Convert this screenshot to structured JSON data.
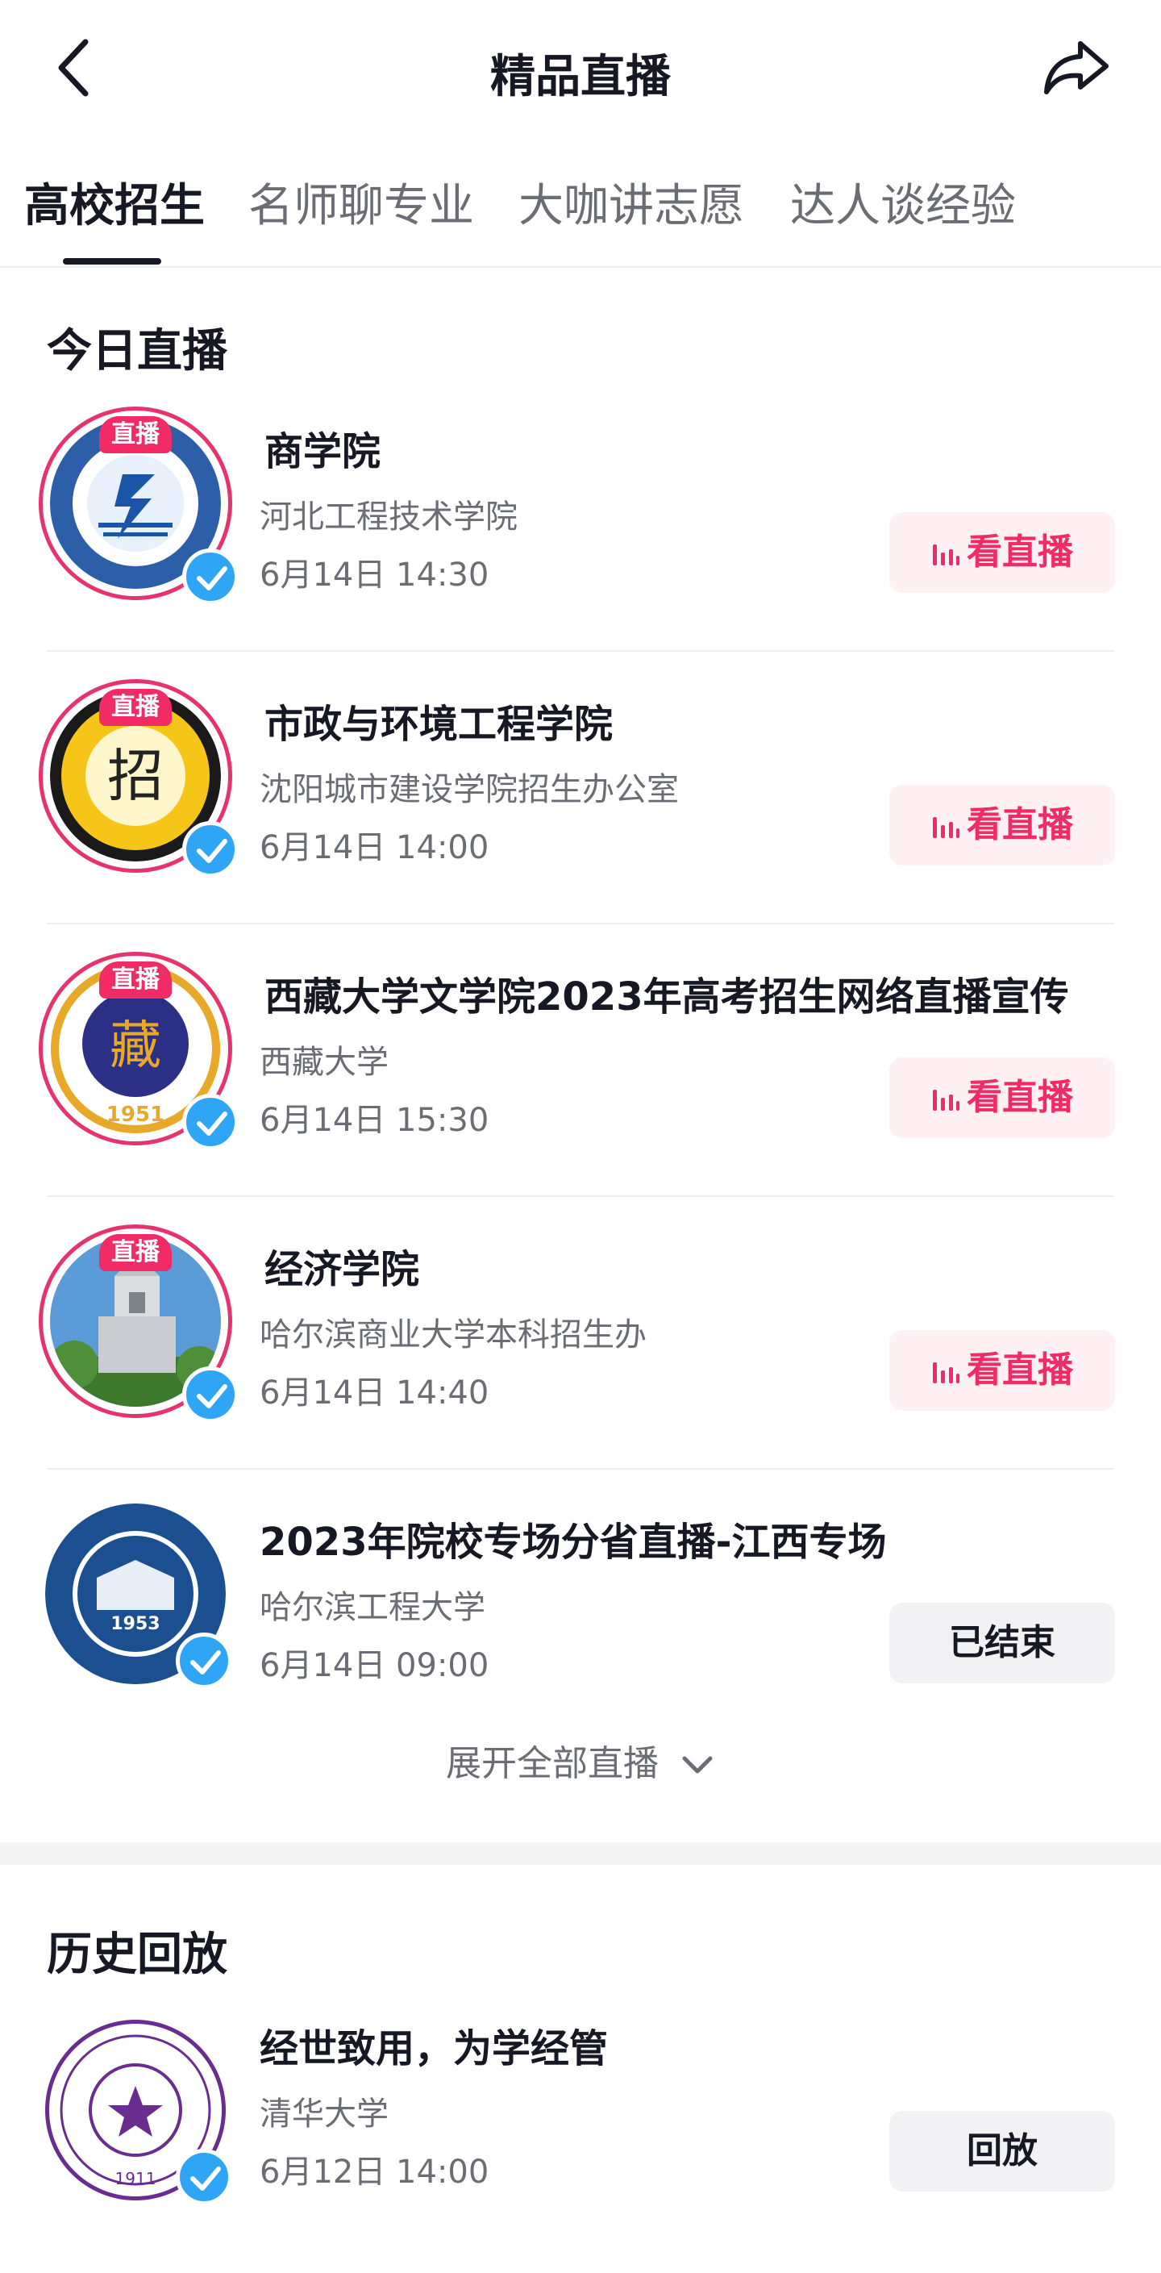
{
  "header": {
    "title": "精品直播",
    "back_icon": "chevron-left-icon",
    "share_icon": "share-arrow-icon"
  },
  "tabs": [
    {
      "label": "高校招生",
      "active": true
    },
    {
      "label": "名师聊专业",
      "active": false
    },
    {
      "label": "大咖讲志愿",
      "active": false
    },
    {
      "label": "达人谈经验",
      "active": false
    }
  ],
  "today": {
    "title": "今日直播",
    "items": [
      {
        "name": "商学院",
        "org": "河北工程技术学院",
        "time": "6月14日 14:30",
        "badge": "直播",
        "action": "看直播",
        "status": "live",
        "avatar": "hebei-polytechnic-logo"
      },
      {
        "name": "市政与环境工程学院",
        "org": "沈阳城市建设学院招生办公室",
        "time": "6月14日 14:00",
        "badge": "直播",
        "action": "看直播",
        "status": "live",
        "avatar": "shenyang-urban-construction-logo"
      },
      {
        "name": "西藏大学文学院2023年高考招生网络直播宣传",
        "org": "西藏大学",
        "time": "6月14日 15:30",
        "badge": "直播",
        "action": "看直播",
        "status": "live",
        "avatar": "tibet-university-logo"
      },
      {
        "name": "经济学院",
        "org": "哈尔滨商业大学本科招生办",
        "time": "6月14日 14:40",
        "badge": "直播",
        "action": "看直播",
        "status": "live",
        "avatar": "building-photo"
      },
      {
        "name": "2023年院校专场分省直播-江西专场",
        "org": "哈尔滨工程大学",
        "time": "6月14日 09:00",
        "badge": "",
        "action": "已结束",
        "status": "ended",
        "avatar": "harbin-engineering-logo"
      }
    ],
    "expand_label": "展开全部直播"
  },
  "history": {
    "title": "历史回放",
    "items": [
      {
        "name": "经世致用，为学经管",
        "org": "清华大学",
        "time": "6月12日 14:00",
        "action": "回放",
        "status": "replay",
        "avatar": "tsinghua-logo"
      }
    ]
  },
  "colors": {
    "accent": "#f02b65",
    "live_button_bg": "#fff0f3",
    "verify": "#2fa6f5"
  }
}
